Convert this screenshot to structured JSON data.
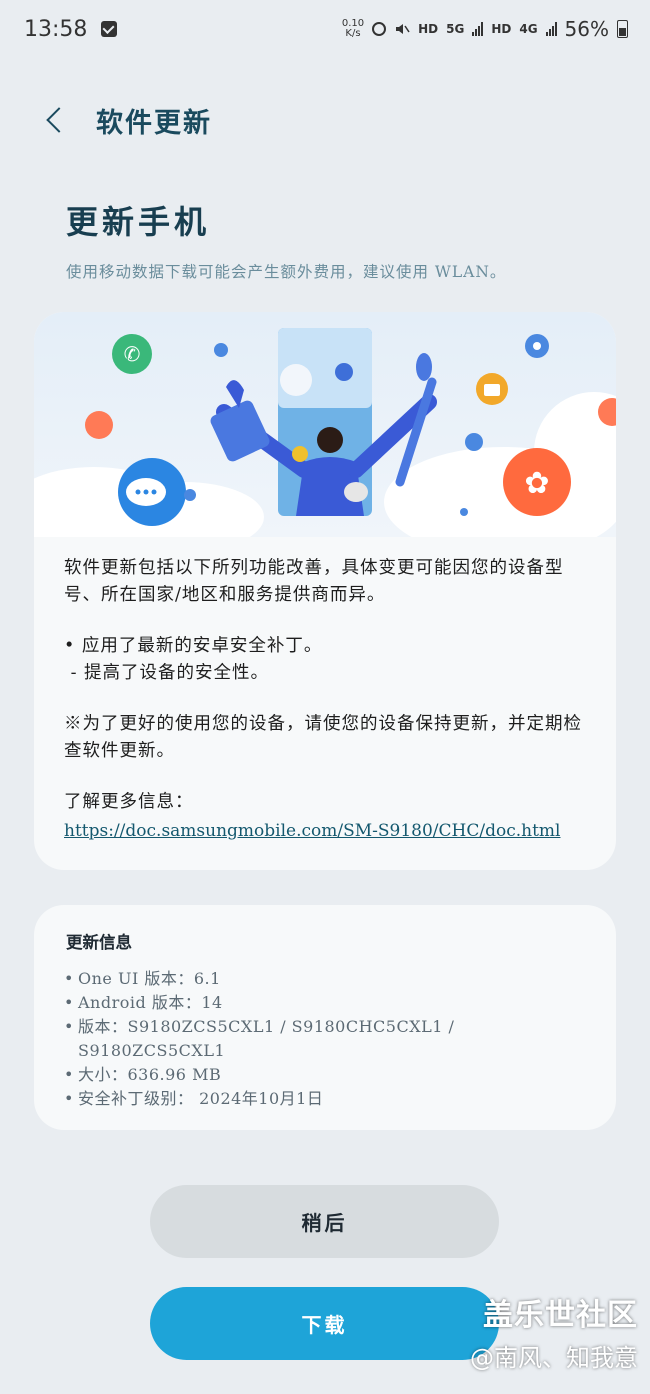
{
  "status_bar": {
    "time": "13:58",
    "speed_value": "0.10",
    "speed_unit": "K/s",
    "hd1": "HD",
    "net5g": "5G",
    "hd2": "HD",
    "net4g": "4G",
    "battery": "56%"
  },
  "header": {
    "title": "软件更新"
  },
  "page": {
    "title": "更新手机",
    "subtitle": "使用移动数据下载可能会产生额外费用，建议使用 WLAN。"
  },
  "release_notes": {
    "intro": "软件更新包括以下所列功能改善，具体变更可能因您的设备型号、所在国家/地区和服务提供商而异。",
    "bullet": "• 应用了最新的安卓安全补丁。",
    "sub_bullet": " - 提高了设备的安全性。",
    "note": "※为了更好的使用您的设备，请使您的设备保持更新，并定期检查软件更新。",
    "more_label": "了解更多信息：",
    "link": "https://doc.samsungmobile.com/SM-S9180/CHC/doc.html"
  },
  "update_info": {
    "title": "更新信息",
    "items": [
      "One UI 版本：6.1",
      "Android 版本：14",
      "版本：S9180ZCS5CXL1 / S9180CHC5CXL1 / S9180ZCS5CXL1",
      "大小：636.96 MB",
      "安全补丁级别： 2024年10月1日"
    ]
  },
  "buttons": {
    "later": "稍后",
    "download": "下载"
  },
  "watermark": {
    "line1": "盖乐世社区",
    "line2": "@南风、知我意"
  },
  "colors": {
    "accent": "#1ea4d8",
    "title": "#183e50",
    "background": "#e9edf1",
    "card": "#f7f9fa"
  }
}
